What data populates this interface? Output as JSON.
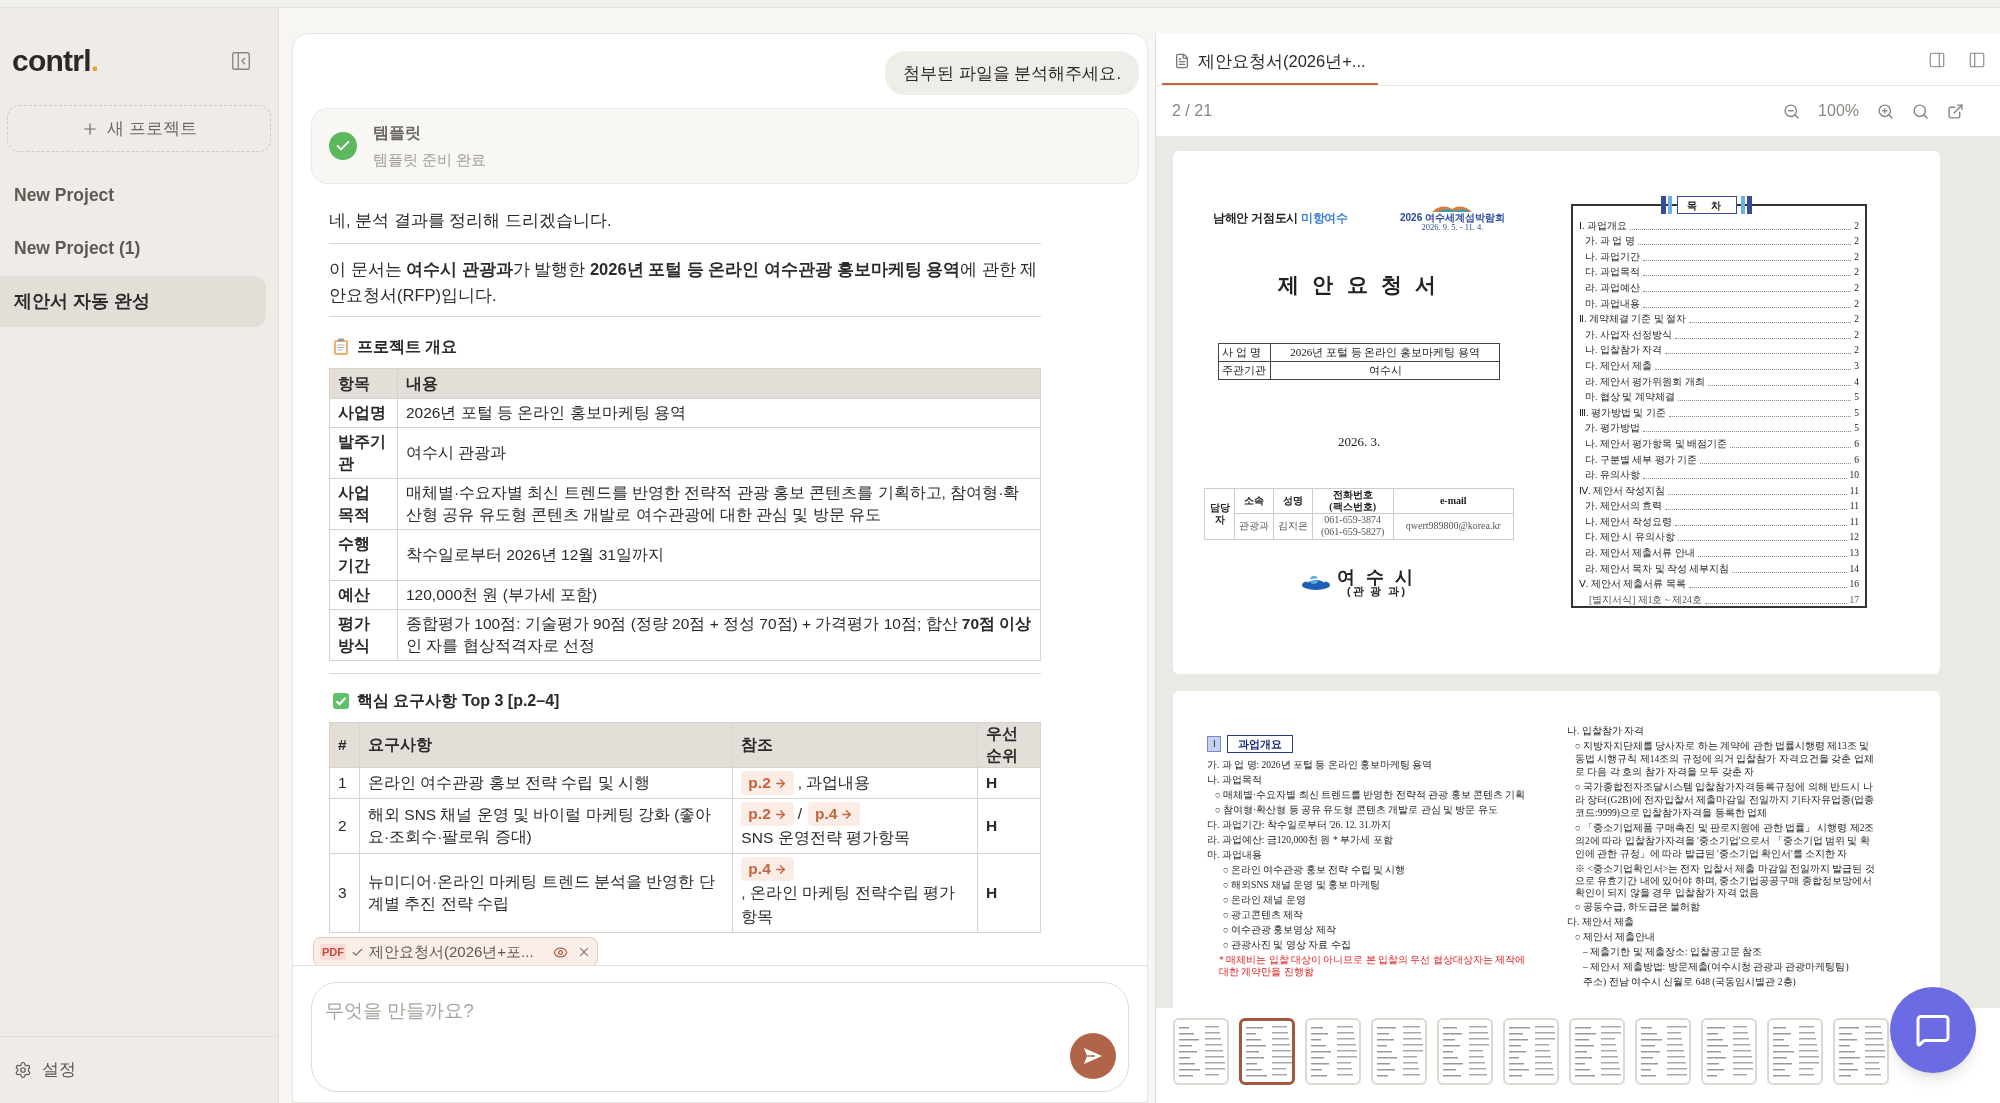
{
  "sidebar": {
    "logo": "contrl",
    "logo_dot": ".",
    "new_project": "새 프로젝트",
    "projects": [
      {
        "label": "New Project",
        "selected": false
      },
      {
        "label": "New Project (1)",
        "selected": false
      },
      {
        "label": "제안서 자동 완성",
        "selected": true
      }
    ],
    "settings": "설정"
  },
  "chat": {
    "user_message": "첨부된 파일을 분석해주세요.",
    "status_card": {
      "title": "템플릿",
      "subtitle": "템플릿 준비 완료",
      "done": true
    },
    "intro": "네, 분석 결과를 정리해 드리겠습니다.",
    "summary": "이 문서는 **여수시 관광과**가 발행한 **2026년 포털 등 온라인 여수관광 홍보마케팅 용역**에 관한 제안요청서(RFP)입니다.",
    "overview": {
      "title": "프로젝트 개요",
      "columns": [
        "항목",
        "내용"
      ],
      "rows": [
        {
          "label": "사업명",
          "value": "2026년 포털 등 온라인 홍보마케팅 용역"
        },
        {
          "label": "발주기관",
          "value": "여수시 관광과"
        },
        {
          "label": "사업 목적",
          "value": "매체별·수요자별 최신 트렌드를 반영한 전략적 관광 홍보 콘텐츠를 기획하고, 참여형·확산형 공유 유도형 콘텐츠 개발로 여수관광에 대한 관심 및 방문 유도"
        },
        {
          "label": "수행 기간",
          "value": "착수일로부터 2026년 12월 31일까지"
        },
        {
          "label": "예산",
          "value": "120,000천 원 (부가세 포함)"
        },
        {
          "label": "평가 방식",
          "value": "종합평가 100점: 기술평가 90점 (정량 20점 + 정성 70점) + 가격평가 10점; 합산 **70점 이상**인 자를 협상적격자로 선정"
        }
      ]
    },
    "requirements": {
      "title": "핵심 요구사항 Top 3 [p.2–4]",
      "columns": [
        "#",
        "요구사항",
        "참조",
        "우선순위"
      ],
      "rows": [
        {
          "no": "1",
          "text": "온라인 여수관광 홍보 전략 수립 및 시행",
          "refs": [
            {
              "kind": "link",
              "text": "p.2"
            },
            {
              "kind": "text",
              "text": ", 과업내용"
            }
          ],
          "priority": "H"
        },
        {
          "no": "2",
          "text": "해외 SNS 채널 운영 및 바이럴 마케팅 강화 (좋아요·조회수·팔로워 증대)",
          "refs": [
            {
              "kind": "link",
              "text": "p.2"
            },
            {
              "kind": "text",
              "text": "/"
            },
            {
              "kind": "link",
              "text": "p.4"
            },
            {
              "kind": "text",
              "text": "SNS 운영전략 평가항목"
            }
          ],
          "priority": "H"
        },
        {
          "no": "3",
          "text": "뉴미디어·온라인 마케팅 트렌드 분석을 반영한 단계별 추진 전략 수립",
          "refs": [
            {
              "kind": "link",
              "text": "p.4"
            },
            {
              "kind": "text",
              "text": ", 온라인 마케팅 전략수립 평가항목"
            }
          ],
          "priority": "H"
        }
      ]
    },
    "attachment": {
      "type": "PDF",
      "name": "제안요청서(2026년+포...",
      "uploaded": true
    },
    "input": {
      "placeholder": "무엇을 만들까요?"
    }
  },
  "viewer": {
    "tab": {
      "title": "제안요청서(2026년+...",
      "selected": true
    },
    "page_indicator": "2 / 21",
    "zoom": "100%",
    "cover": {
      "slogan": "남해안 거점도시",
      "slogan_accent": "미항여수",
      "expo_year": "2026",
      "expo_name": "여수세계섬박람회",
      "expo_dates": "2026. 9. 5. - 11. 4.",
      "title": "제 안 요 청 서",
      "info": [
        {
          "label": "사 업 명",
          "value": "2026년 포털 등 온라인 홍보마케팅 용역"
        },
        {
          "label": "주관기관",
          "value": "여수시"
        }
      ],
      "date": "2026. 3.",
      "contact": {
        "row_label": "담당자",
        "columns": [
          "소속",
          "성명",
          "전화번호\n(팩스번호)",
          "e-mail"
        ],
        "values": [
          "관광과",
          "김지은",
          "061-659-3874\n(061-659-5827)",
          "qwert989800@korea.kr"
        ]
      },
      "issuer": "여 수 시",
      "issuer_dept": "(관 광 과)",
      "toc_title": "목 차",
      "toc": [
        {
          "kind": "chapter",
          "text": "Ⅰ. 과업개요",
          "page": "2"
        },
        {
          "kind": "section",
          "text": "가. 과 업 명",
          "page": "2"
        },
        {
          "kind": "section",
          "text": "나. 과업기간",
          "page": "2"
        },
        {
          "kind": "section",
          "text": "다. 과업목적",
          "page": "2"
        },
        {
          "kind": "section",
          "text": "라. 과업예산",
          "page": "2"
        },
        {
          "kind": "section",
          "text": "마. 과업내용",
          "page": "2"
        },
        {
          "kind": "chapter",
          "text": "Ⅱ. 계약체결 기준 및 절차",
          "page": "2"
        },
        {
          "kind": "section",
          "text": "가. 사업자 선정방식",
          "page": "2"
        },
        {
          "kind": "section",
          "text": "나. 입찰참가 자격",
          "page": "2"
        },
        {
          "kind": "section",
          "text": "다. 제안서 제출",
          "page": "3"
        },
        {
          "kind": "section",
          "text": "라. 제안서 평가위원회 개최",
          "page": "4"
        },
        {
          "kind": "section",
          "text": "마. 협상 및 계약체결",
          "page": "5"
        },
        {
          "kind": "chapter",
          "text": "Ⅲ. 평가방법 및 기준",
          "page": "5"
        },
        {
          "kind": "section",
          "text": "가. 평가방법",
          "page": "5"
        },
        {
          "kind": "section",
          "text": "나. 제안서 평가항목 및 배점기준",
          "page": "6"
        },
        {
          "kind": "section",
          "text": "다. 구분별 세부 평가 기준",
          "page": "6"
        },
        {
          "kind": "section",
          "text": "라. 유의사항",
          "page": "10"
        },
        {
          "kind": "chapter",
          "text": "Ⅳ. 제안서 작성지침",
          "page": "11"
        },
        {
          "kind": "section",
          "text": "가. 제안서의 효력",
          "page": "11"
        },
        {
          "kind": "section",
          "text": "나. 제안서 작성요령",
          "page": "11"
        },
        {
          "kind": "section",
          "text": "다. 제안 시 유의사항",
          "page": "12"
        },
        {
          "kind": "section",
          "text": "라. 제안서 제출서류 안내",
          "page": "13"
        },
        {
          "kind": "section",
          "text": "라. 제안서 목차 및 작성 세부지침",
          "page": "14"
        },
        {
          "kind": "chapter",
          "text": "Ⅴ. 제안서 제출서류 목록",
          "page": "16"
        },
        {
          "kind": "appendix",
          "text": "[별지서식] 제1호 ~ 제24호",
          "page": "17"
        }
      ]
    },
    "content_page": {
      "section_no": "Ⅰ",
      "section_title": "과업개요",
      "left": [
        {
          "kind": "top",
          "text": "가. 과 업 명: 2026년 포털 등 온라인 홍보마케팅 용역"
        },
        {
          "kind": "top",
          "text": "나. 과업목적"
        },
        {
          "kind": "sub",
          "text": "○ 매체별·수요자별 최신 트렌드를 반영한 전략적 관광 홍보 콘텐츠 기획"
        },
        {
          "kind": "sub",
          "text": "○ 참여형·확산형 등 공유 유도형 콘텐츠 개발로 관심 및 방문 유도"
        },
        {
          "kind": "top",
          "text": "다. 과업기간: 착수일로부터 '26. 12. 31.까지"
        },
        {
          "kind": "top",
          "text": "라. 과업예산: 금120,000천 원",
          "note": "* 부가세 포함"
        },
        {
          "kind": "top",
          "text": "마. 과업내용"
        },
        {
          "kind": "deep",
          "text": "○ 온라인 여수관광 홍보 전략 수립 및 시행"
        },
        {
          "kind": "deep",
          "text": "○ 해외SNS 채널 운영 및 홍보 마케팅"
        },
        {
          "kind": "deep",
          "text": "○ 온라인 채널 운영"
        },
        {
          "kind": "deep",
          "text": "○ 광고콘텐츠 제작"
        },
        {
          "kind": "deep",
          "text": "○ 여수관광 홍보영상 제작"
        },
        {
          "kind": "deep",
          "text": "○ 관광사진 및 영상 자료 수집"
        },
        {
          "kind": "warning",
          "text": "* 매체비는 입찰 대상이 아니므로 본 입찰의 우선 협상대상자는 제작에 대한 계약만을 진행함"
        }
      ],
      "right": [
        {
          "kind": "top",
          "text": "나. 입찰참가 자격"
        },
        {
          "kind": "sub",
          "text": "○ 지방자치단체를 당사자로 하는 계약에 관한 법률시행령 제13조 및 동법 시행규칙 제14조의 규정에 의거 입찰참가 자격요건을 갖춘 업체로 다음 각 호의 참가 자격을 모두 갖춘 자"
        },
        {
          "kind": "sub",
          "text": "○ 국가종합전자조달시스템 입찰참가자격등록규정에 의해 반드시 나라 장터(G2B)에 전자입찰서 제출마감일 전일까지 기타자유업종(업종코드:9999)으로 입찰참가자격을 등록한 업체"
        },
        {
          "kind": "sub",
          "text": "○ 「중소기업제품 구매촉진 및 판로지원에 관한 법률」 시행령 제2조의2에 따라 입찰참가자격을 '중소기업'으로서 「중소기업 범위 및 확인에 관한 규정」에 따라 발급된 '중소기업 확인서'를 소지한 자"
        },
        {
          "kind": "note",
          "text": "※ <중소기업확인서>는 전자 입찰서 제출 마감일 전일까지 발급된 것으로 유효기간 내에 있어야 하며, 중소기업공공구매 종합정보망에서 확인이 되지 않을 경우 입찰참가 자격 없음"
        },
        {
          "kind": "sub",
          "text": "○ 공동수급, 하도급은 불허함"
        },
        {
          "kind": "top",
          "text": "다. 제안서 제출"
        },
        {
          "kind": "sub",
          "text": "○ 제안서 제출안내"
        },
        {
          "kind": "deep",
          "text": "– 제출기한 및 제출장소: 입찰공고문 참조"
        },
        {
          "kind": "deep",
          "text": "– 제안서 제출방법: 방문제출(여수시청 관광과 관광마케팅팀)"
        },
        {
          "kind": "deep",
          "text": "주소) 전남 여수시 신월로 648 (국동임시별관 2층)"
        }
      ]
    },
    "thumbnails": [
      {
        "selected": false
      },
      {
        "selected": true
      },
      {
        "selected": false
      },
      {
        "selected": false
      },
      {
        "selected": false
      },
      {
        "selected": false
      },
      {
        "selected": false
      },
      {
        "selected": false
      },
      {
        "selected": false
      },
      {
        "selected": false
      },
      {
        "selected": false
      }
    ]
  }
}
